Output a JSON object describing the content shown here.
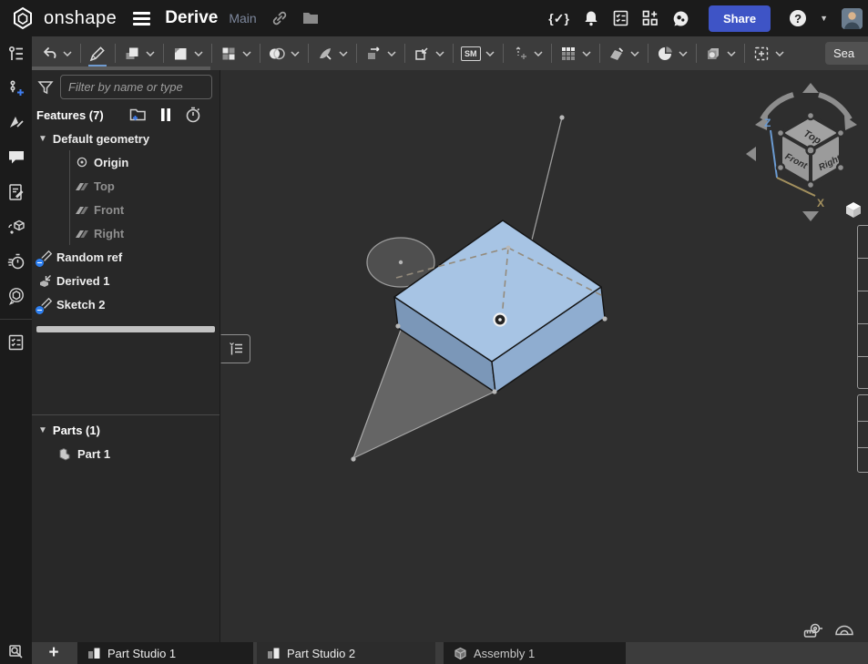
{
  "topbar": {
    "brand": "onshape",
    "document_title": "Derive",
    "workspace_name": "Main",
    "versions_glyph": "{✓}",
    "share_button": "Share",
    "help_label": "?",
    "right_icons": [
      "versions-icon",
      "notifications-bell-icon",
      "tasks-checklist-icon",
      "app-store-icon",
      "learning-center-icon",
      "help-icon",
      "avatar"
    ]
  },
  "toolbar": {
    "sm_label": "SM",
    "search_value": "Sea",
    "groups": [
      "undo",
      "sketch",
      "extrude",
      "fillet",
      "pattern",
      "boolean",
      "split",
      "transform",
      "modify",
      "sheet-metal",
      "move",
      "pattern-grid",
      "surface",
      "section-analysis",
      "appearance",
      "insert"
    ]
  },
  "left_rail": {
    "items": [
      "feature-manager",
      "versions-history",
      "annotations",
      "comments",
      "notes",
      "part-help",
      "performance",
      "feedback",
      "checklist",
      "search-tabs"
    ]
  },
  "feature_panel": {
    "filter_placeholder": "Filter by name or type",
    "features_header": "Features (7)",
    "header_icons": [
      "add-folder-icon",
      "suspend-icon",
      "regenerate-timer-icon"
    ],
    "default_geometry_label": "Default geometry",
    "default_children": [
      "Origin",
      "Top",
      "Front",
      "Right"
    ],
    "features": [
      "Random ref",
      "Derived 1",
      "Sketch 2"
    ],
    "parts_header": "Parts (1)",
    "parts": [
      "Part 1"
    ]
  },
  "viewcube": {
    "top": "Top",
    "front": "Front",
    "right": "Right",
    "axis_z": "Z",
    "axis_x": "X"
  },
  "viewport_tools": [
    "tape-measure-icon",
    "protractor-icon"
  ],
  "tabbar": {
    "add_label": "+",
    "tabs": [
      {
        "label": "Part Studio 1",
        "type": "part-studio",
        "active": false
      },
      {
        "label": "Part Studio 2",
        "type": "part-studio",
        "active": true
      },
      {
        "label": "Assembly 1",
        "type": "assembly",
        "active": false
      }
    ]
  },
  "colors": {
    "share_blue": "#3e54c6",
    "badge_blue": "#2d7ff0",
    "sketch_active_underline": "#6f9bd1",
    "part_top_face": "#a7c4e4",
    "part_front_face": "#7b97b8",
    "part_right_face": "#8fadd0",
    "viewport_bg": "#2e2e2e",
    "panel_bg": "#282828",
    "topbar_bg": "#1b1b1b",
    "toolbar_bg": "#3c3c3c"
  }
}
